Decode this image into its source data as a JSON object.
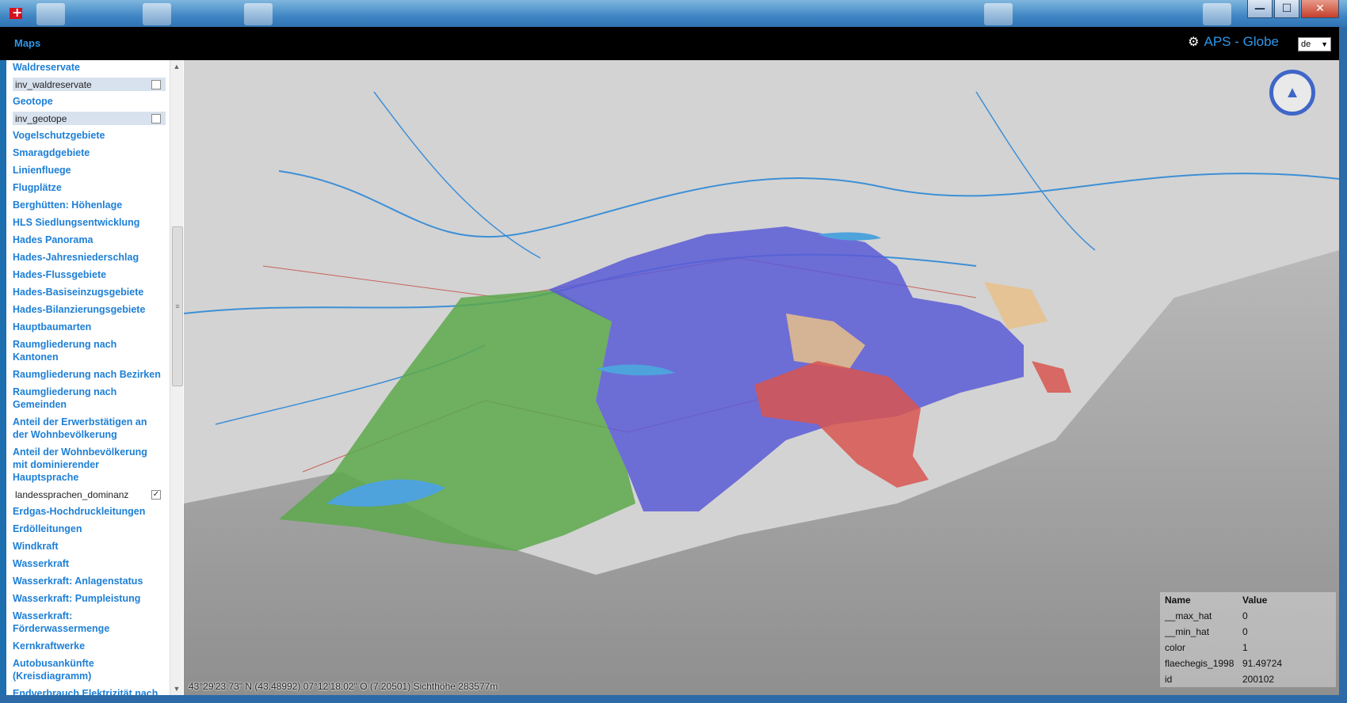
{
  "window": {
    "minimize": "—",
    "maximize": "☐",
    "close": "✕"
  },
  "header": {
    "app_label": "Maps",
    "title": "APS - Globe",
    "language": "de"
  },
  "sidebar": {
    "items": [
      {
        "kind": "item",
        "label": "Waldreservate"
      },
      {
        "kind": "layer",
        "label": "inv_waldreservate",
        "checked": false
      },
      {
        "kind": "item",
        "label": "Geotope"
      },
      {
        "kind": "layer",
        "label": "inv_geotope",
        "checked": false
      },
      {
        "kind": "item",
        "label": "Vogelschutzgebiete"
      },
      {
        "kind": "item",
        "label": "Smaragdgebiete"
      },
      {
        "kind": "item",
        "label": "Linienfluege"
      },
      {
        "kind": "item",
        "label": "Flugplätze"
      },
      {
        "kind": "item",
        "label": "Berghütten: Höhenlage"
      },
      {
        "kind": "item",
        "label": "HLS Siedlungsentwicklung"
      },
      {
        "kind": "item",
        "label": "Hades Panorama"
      },
      {
        "kind": "item",
        "label": "Hades-Jahresniederschlag"
      },
      {
        "kind": "item",
        "label": "Hades-Flussgebiete"
      },
      {
        "kind": "item",
        "label": "Hades-Basiseinzugsgebiete"
      },
      {
        "kind": "item",
        "label": "Hades-Bilanzierungsgebiete"
      },
      {
        "kind": "item",
        "label": "Hauptbaumarten"
      },
      {
        "kind": "item",
        "label": "Raumgliederung nach Kantonen"
      },
      {
        "kind": "item",
        "label": "Raumgliederung nach Bezirken"
      },
      {
        "kind": "item",
        "label": "Raumgliederung nach Gemeinden"
      },
      {
        "kind": "item",
        "label": "Anteil der Erwerbstätigen an der Wohnbevölkerung"
      },
      {
        "kind": "item",
        "label": "Anteil der Wohnbevölkerung mit dominierender Hauptsprache"
      },
      {
        "kind": "layer",
        "label": "landessprachen_dominanz",
        "checked": true
      },
      {
        "kind": "item",
        "label": "Erdgas-Hochdruckleitungen"
      },
      {
        "kind": "item",
        "label": "Erdölleitungen"
      },
      {
        "kind": "item",
        "label": "Windkraft"
      },
      {
        "kind": "item",
        "label": "Wasserkraft"
      },
      {
        "kind": "item",
        "label": "Wasserkraft: Anlagenstatus"
      },
      {
        "kind": "item",
        "label": "Wasserkraft: Pumpleistung"
      },
      {
        "kind": "item",
        "label": "Wasserkraft: Förderwassermenge"
      },
      {
        "kind": "item",
        "label": "Kernkraftwerke"
      },
      {
        "kind": "item",
        "label": "Autobusankünfte (Kreisdiagramm)"
      },
      {
        "kind": "item",
        "label": "Endverbrauch Elektrizität nach Verbrauchergruppe (Ringdiagramm)"
      }
    ]
  },
  "map": {
    "coordinates": "43°29'23.73\" N (43.48992) 07°12'18.02\" O (7.20501) Sichthöhe 283577m",
    "colors": {
      "french": "#5ca84b",
      "german": "#5a5ad6",
      "italian": "#d8554f",
      "romansh": "#e8c08a"
    }
  },
  "properties": {
    "header": {
      "name": "Name",
      "value": "Value"
    },
    "rows": [
      {
        "name": "__max_hat",
        "value": "0"
      },
      {
        "name": "__min_hat",
        "value": "0"
      },
      {
        "name": "color",
        "value": "1"
      },
      {
        "name": "flaechegis_1998",
        "value": "91.49724"
      },
      {
        "name": "id",
        "value": "200102"
      }
    ]
  }
}
